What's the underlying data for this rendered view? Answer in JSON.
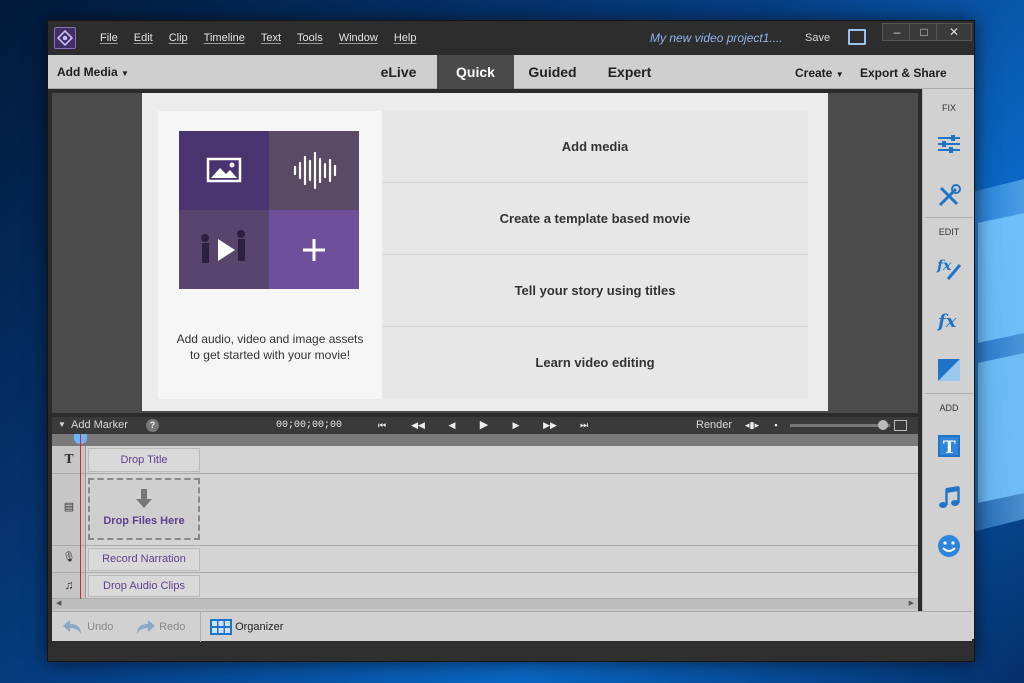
{
  "window": {
    "menu": [
      "File",
      "Edit",
      "Clip",
      "Timeline",
      "Text",
      "Tools",
      "Window",
      "Help"
    ],
    "project_title": "My new video project1....",
    "save_label": "Save",
    "controls": [
      "–",
      "□",
      "✕"
    ]
  },
  "modebar": {
    "add_media": "Add Media",
    "modes": [
      "eLive",
      "Quick",
      "Guided",
      "Expert"
    ],
    "active_mode": "Quick",
    "create": "Create",
    "export_share": "Export & Share"
  },
  "welcome": {
    "caption_line1": "Add audio, video and image assets",
    "caption_line2": "to get started with your movie!",
    "options": [
      "Add media",
      "Create a template based movie",
      "Tell your story using titles",
      "Learn video editing"
    ]
  },
  "sidebar": {
    "sections": [
      "FIX",
      "EDIT",
      "ADD"
    ],
    "icons": [
      "adjustments-icon",
      "tools-icon",
      "fx-edit-icon",
      "fx-icon",
      "transition-icon",
      "title-icon",
      "music-icon",
      "graphics-icon"
    ]
  },
  "timeline": {
    "add_marker": "Add Marker",
    "help": "?",
    "timecode": "00;00;00;00",
    "render": "Render",
    "tracks": {
      "title": "Drop Title",
      "video": "Drop Files Here",
      "narration": "Record Narration",
      "audio": "Drop Audio Clips"
    },
    "track_glyphs": [
      "T",
      "▤",
      "🎙",
      "♫"
    ]
  },
  "bottom": {
    "undo": "Undo",
    "redo": "Redo",
    "organizer": "Organizer"
  },
  "colors": {
    "accent_purple": "#5b3f8c",
    "tile_dark": "#4a3470",
    "tile_light": "#6e4f9a",
    "sidebar_icon_blue": "#1f74c8",
    "playhead": "#dd2222"
  }
}
